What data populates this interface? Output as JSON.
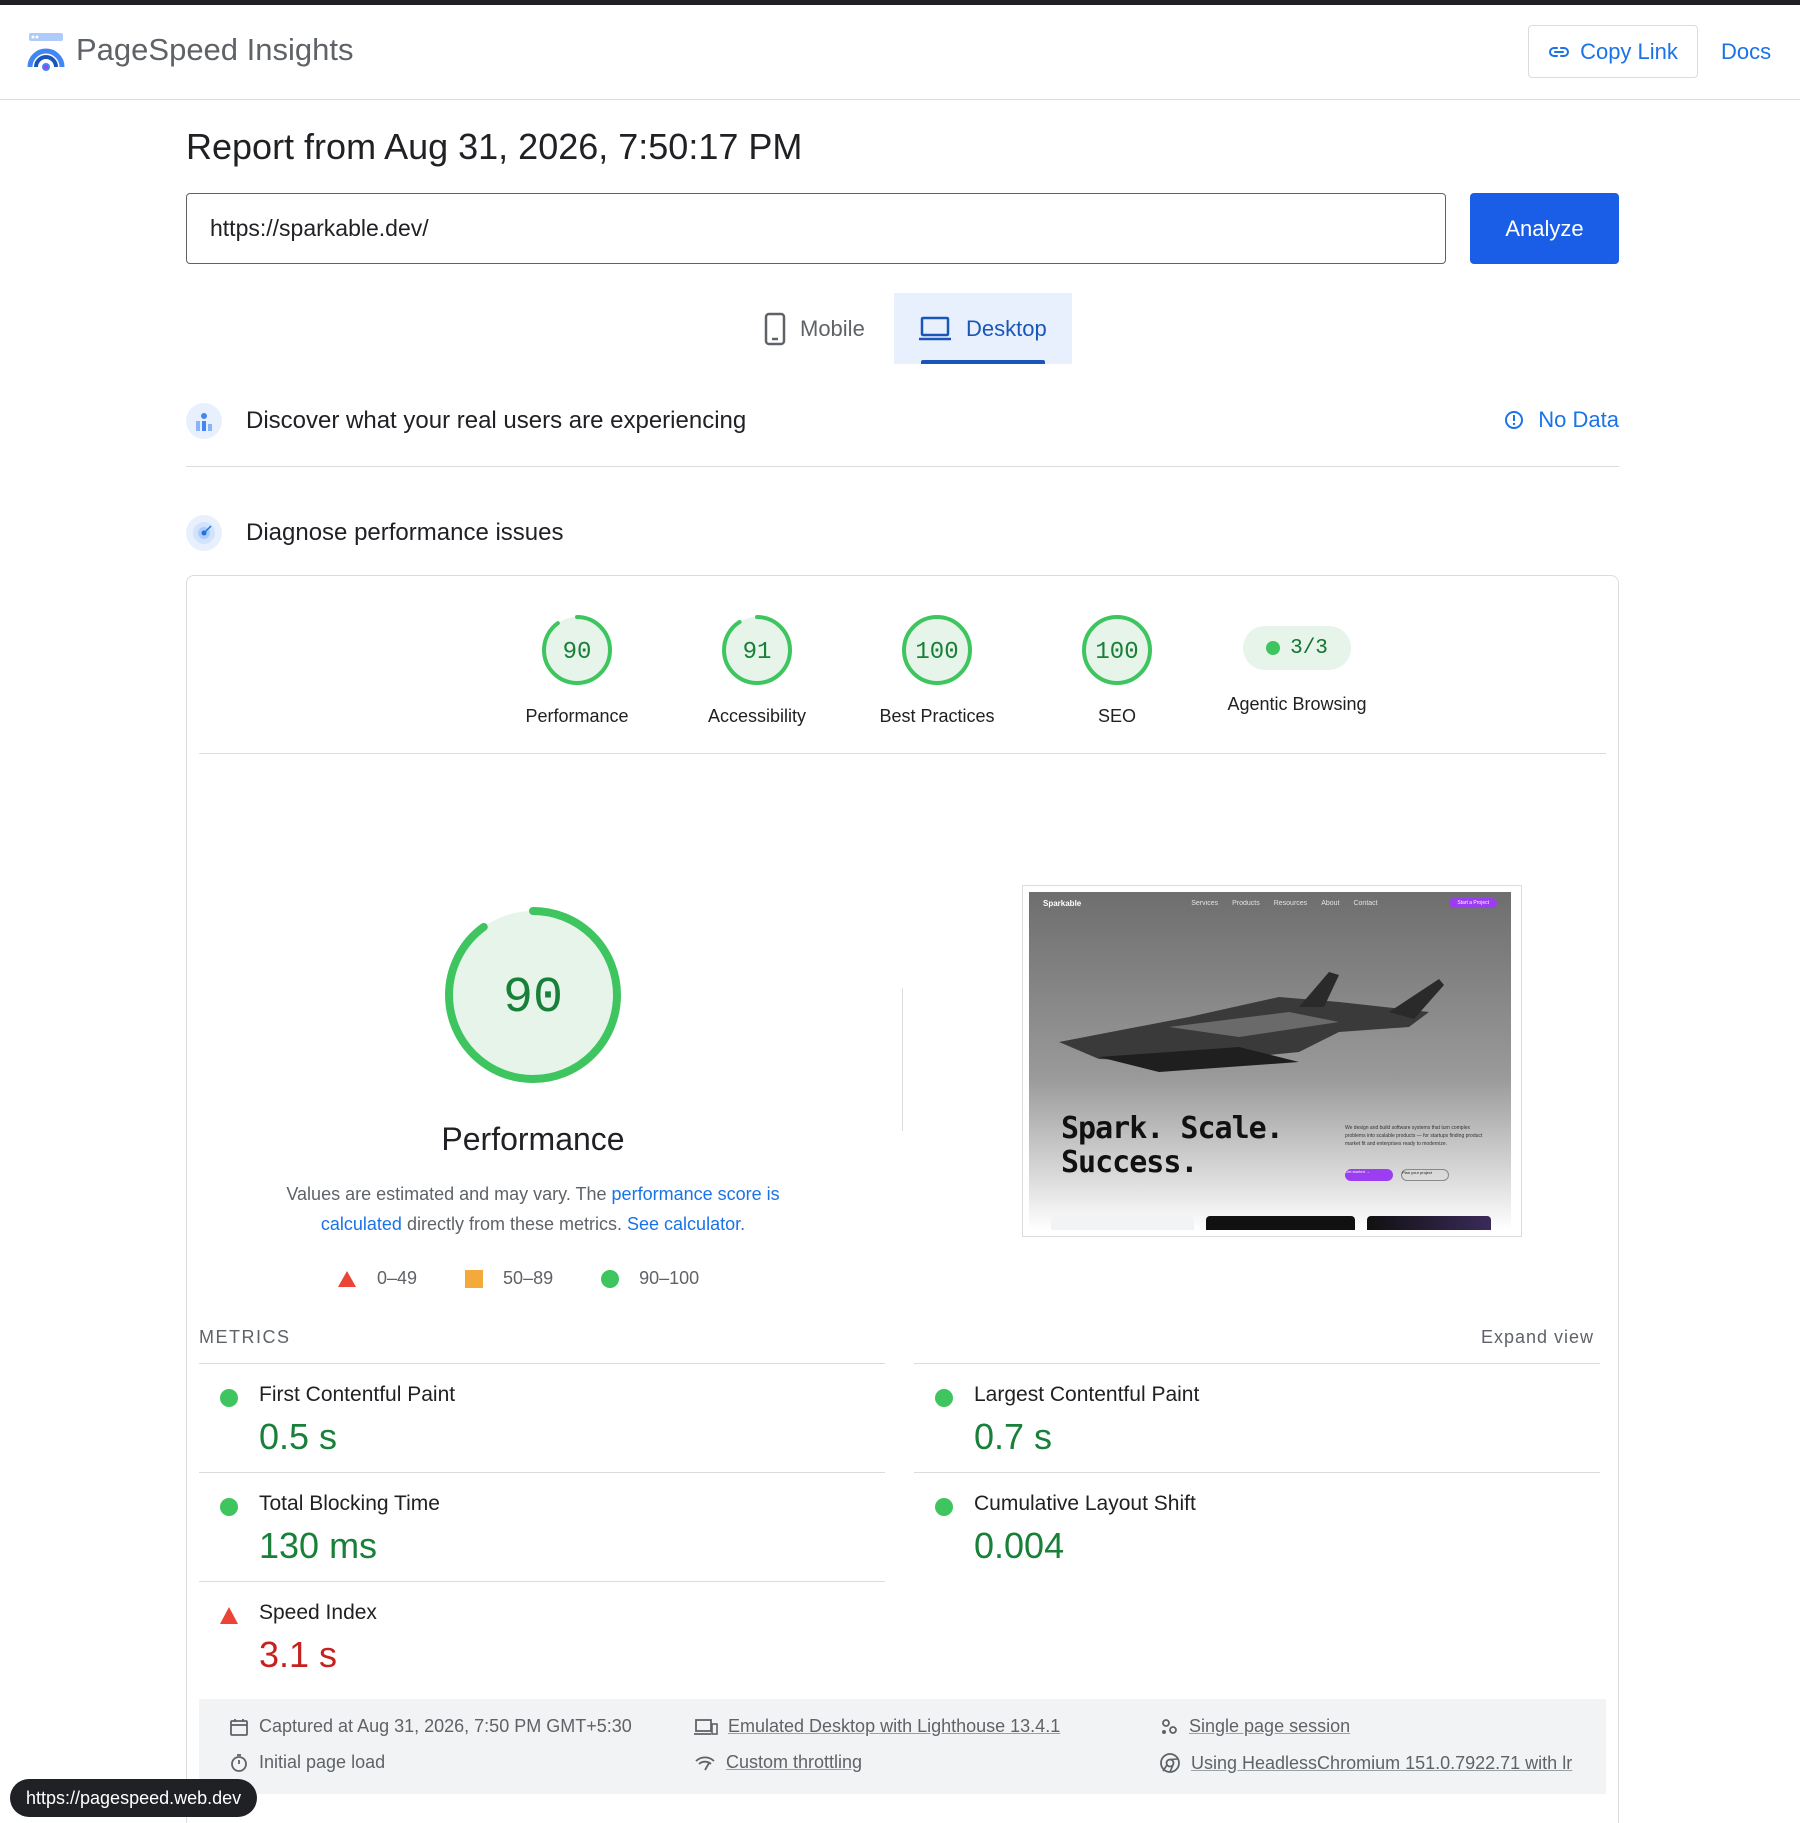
{
  "header": {
    "app_title": "PageSpeed Insights",
    "copy_link_label": "Copy Link",
    "docs_label": "Docs"
  },
  "report": {
    "title": "Report from Aug 31, 2026, 7:50:17 PM",
    "url_value": "https://sparkable.dev/",
    "analyze_label": "Analyze"
  },
  "tabs": [
    {
      "label": "Mobile",
      "icon": "phone-icon",
      "selected": false
    },
    {
      "label": "Desktop",
      "icon": "laptop-icon",
      "selected": true
    }
  ],
  "crux": {
    "title": "Discover what your real users are experiencing",
    "status": "No Data"
  },
  "diagnose": {
    "title": "Diagnose performance issues"
  },
  "scores": [
    {
      "label": "Performance",
      "value": "90",
      "score": 90
    },
    {
      "label": "Accessibility",
      "value": "91",
      "score": 91
    },
    {
      "label": "Best Practices",
      "value": "100",
      "score": 100
    },
    {
      "label": "SEO",
      "value": "100",
      "score": 100
    }
  ],
  "agentic": {
    "label": "Agentic Browsing",
    "value": "3/3"
  },
  "performance": {
    "score_text": "90",
    "score": 90,
    "title": "Performance",
    "desc_prefix": "Values are estimated and may vary. The ",
    "desc_link1": "performance score is calculated",
    "desc_middle": " directly from these metrics. ",
    "desc_link2": "See calculator.",
    "legend": [
      {
        "range": "0–49",
        "shape": "triangle",
        "color": "#eb4335"
      },
      {
        "range": "50–89",
        "shape": "square",
        "color": "#f4a93c"
      },
      {
        "range": "90–100",
        "shape": "circle",
        "color": "#3ec55f"
      }
    ]
  },
  "screenshot": {
    "brand": "Sparkable",
    "nav_links": [
      "Services",
      "Products",
      "Resources",
      "About",
      "Contact"
    ],
    "cta": "Start a Project",
    "headline_1": "Spark. Scale.",
    "headline_2": "Success.",
    "body": "We design and build software systems that turn complex problems into scalable products — for startups finding product market fit and enterprises ready to modernize.",
    "btn_primary": "Get started →",
    "btn_secondary": "Plan your project"
  },
  "metrics": {
    "section_label": "METRICS",
    "expand_label": "Expand view",
    "items": [
      {
        "name": "First Contentful Paint",
        "value": "0.5 s",
        "status": "good"
      },
      {
        "name": "Largest Contentful Paint",
        "value": "0.7 s",
        "status": "good"
      },
      {
        "name": "Total Blocking Time",
        "value": "130 ms",
        "status": "good"
      },
      {
        "name": "Cumulative Layout Shift",
        "value": "0.004",
        "status": "good"
      },
      {
        "name": "Speed Index",
        "value": "3.1 s",
        "status": "poor"
      }
    ]
  },
  "environment": {
    "captured": "Captured at Aug 31, 2026, 7:50 PM GMT+5:30",
    "load": "Initial page load",
    "emulated": "Emulated Desktop with Lighthouse 13.4.1",
    "throttling": "Custom throttling",
    "session": "Single page session",
    "browser": "Using HeadlessChromium 151.0.7922.71 with lr"
  },
  "status_bar": {
    "url": "https://pagespeed.web.dev"
  },
  "colors": {
    "good": "#3ec55f",
    "good_text": "#188038",
    "poor": "#eb4335",
    "accent": "#1a73e8"
  }
}
